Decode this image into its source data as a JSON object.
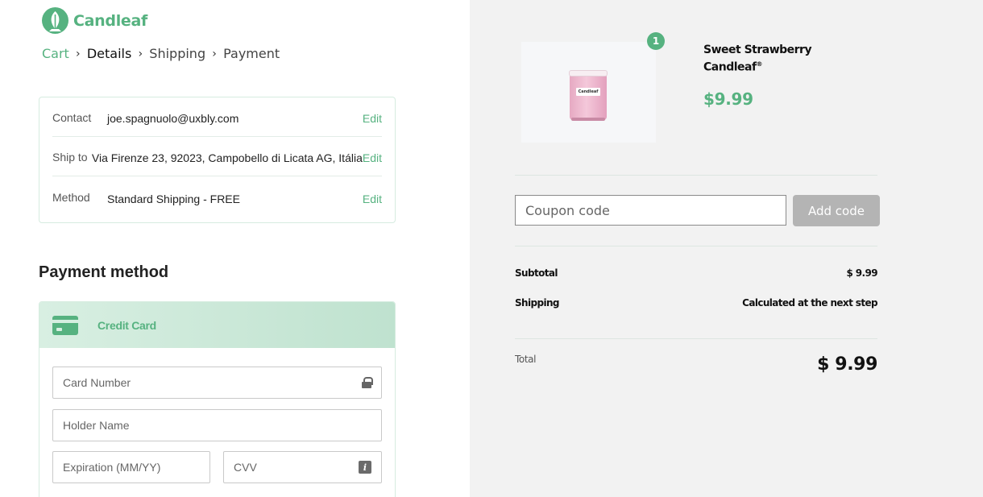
{
  "brand": {
    "name": "Candleaf",
    "accent_color": "#56b280",
    "logo_icon": "leaf-logo-icon"
  },
  "breadcrumb": [
    {
      "label": "Cart",
      "state": "done"
    },
    {
      "label": "Details",
      "state": "current"
    },
    {
      "label": "Shipping",
      "state": "todo"
    },
    {
      "label": "Payment",
      "state": "todo"
    }
  ],
  "breadcrumb_separator": "›",
  "summary_box": {
    "contact": {
      "label": "Contact",
      "value": "joe.spagnuolo@uxbly.com",
      "edit": "Edit"
    },
    "ship_to": {
      "label": "Ship to",
      "value": "Via Firenze 23, 92023, Campobello di Licata AG, Itália",
      "edit": "Edit"
    },
    "method": {
      "label": "Method",
      "value": "Standard Shipping - FREE",
      "edit": "Edit"
    }
  },
  "payment": {
    "title": "Payment method",
    "selected_method": "Credit Card",
    "method_icon": "credit-card-icon",
    "fields": {
      "card_number": {
        "placeholder": "Card Number",
        "icon": "lock-icon"
      },
      "holder_name": {
        "placeholder": "Holder Name"
      },
      "expiration": {
        "placeholder": "Expiration (MM/YY)"
      },
      "cvv": {
        "placeholder": "CVV",
        "icon": "info-icon",
        "icon_glyph": "i"
      }
    }
  },
  "order": {
    "item": {
      "name": "Sweet Strawberry Candleaf",
      "trademark": "®",
      "price": "$9.99",
      "quantity": "1",
      "jar_label": "Candleaf"
    },
    "coupon": {
      "placeholder": "Coupon code",
      "button": "Add code"
    },
    "subtotal": {
      "label": "Subtotal",
      "value": "$ 9.99"
    },
    "shipping": {
      "label": "Shipping",
      "value": "Calculated at the next step"
    },
    "total": {
      "label": "Total",
      "value": "$ 9.99"
    }
  }
}
